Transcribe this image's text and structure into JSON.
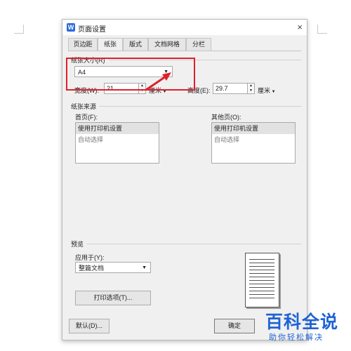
{
  "window": {
    "title": "页面设置",
    "icon_letter": "W",
    "close_glyph": "×"
  },
  "tabs": [
    {
      "label": "页边距",
      "active": false
    },
    {
      "label": "纸张",
      "active": true
    },
    {
      "label": "版式",
      "active": false
    },
    {
      "label": "文档网格",
      "active": false
    },
    {
      "label": "分栏",
      "active": false
    }
  ],
  "paper_size": {
    "label": "纸张大小(R)",
    "value": "A4",
    "width_label": "宽度(W):",
    "width_value": "21",
    "width_unit": "厘米",
    "height_label": "高度(E):",
    "height_value": "29.7",
    "height_unit": "厘米"
  },
  "paper_source": {
    "label": "纸张来源",
    "first_page_label": "首页(F):",
    "other_pages_label": "其他页(O):",
    "first_page_items": [
      "使用打印机设置",
      "自动选择"
    ],
    "other_pages_items": [
      "使用打印机设置",
      "自动选择"
    ]
  },
  "preview": {
    "label": "预览",
    "apply_label": "应用于(Y):",
    "apply_value": "整篇文档",
    "print_options_label": "打印选项(T)..."
  },
  "footer": {
    "default_label": "默认(D)...",
    "ok_label": "确定"
  },
  "watermark": {
    "main": "百科全说",
    "sub": "助你轻松解决"
  },
  "colors": {
    "highlight": "#e0202a",
    "watermark": "#1f63d3",
    "app_icon": "#2b6bd8"
  }
}
